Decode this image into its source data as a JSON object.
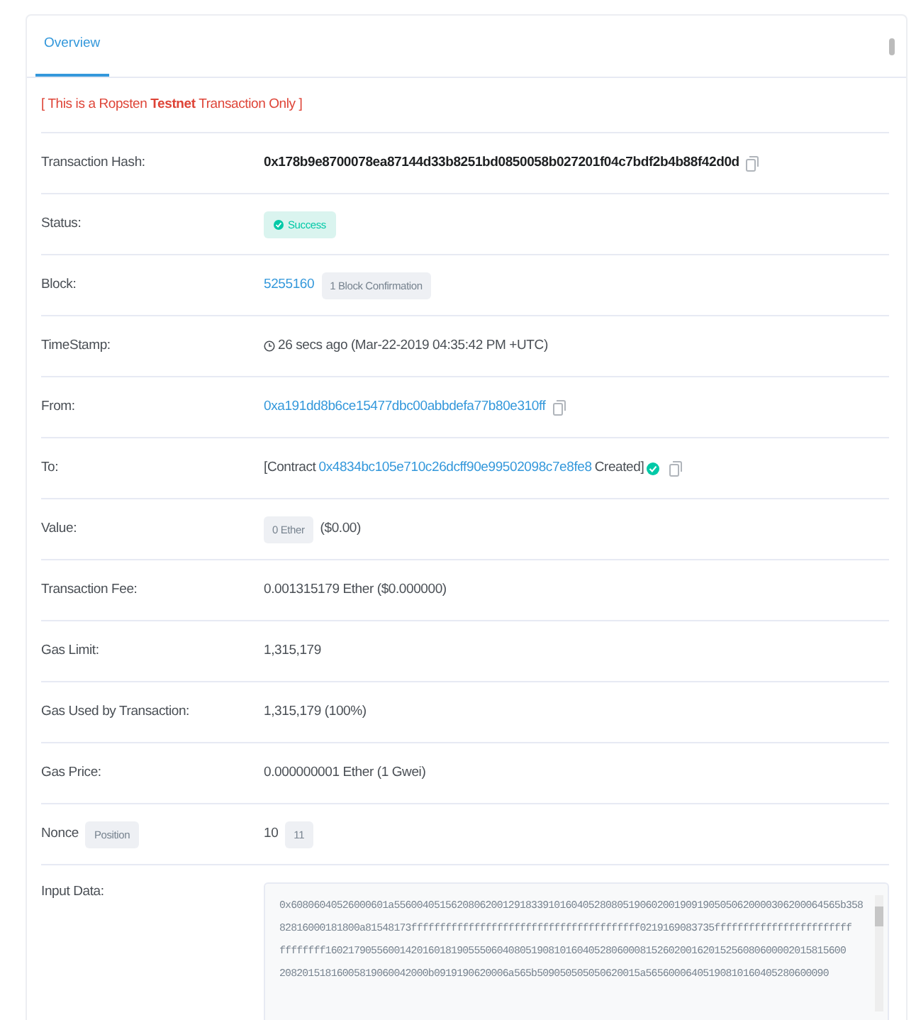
{
  "tabs": [
    {
      "label": "Overview",
      "selected": true
    }
  ],
  "notice": "[ This is a Ropsten **Testnet** Transaction Only ]",
  "rows": [
    {
      "kind": "hash",
      "label": "Transaction Hash:",
      "value": "0x178b9e8700078ea87144d33b8251bd0850058b027201f04c7bdf2b4b88f42d0d"
    },
    {
      "kind": "status",
      "label": "Status:",
      "value": "Success"
    },
    {
      "kind": "block",
      "label": "Block:",
      "value": "5255160",
      "badge": "1 Block Confirmation"
    },
    {
      "kind": "time",
      "label": "TimeStamp:",
      "value": "26 secs ago (Mar-22-2019 04:35:42 PM +UTC)"
    },
    {
      "kind": "address",
      "label": "From:",
      "value": "0xa191dd8b6ce15477dbc00abbdefa77b80e310ff"
    },
    {
      "kind": "contract",
      "label": "To:",
      "prefix": "[Contract",
      "value": "0x4834bc105e710c26dcff90e99502098c7e8fe8",
      "suffix": "Created]"
    },
    {
      "kind": "amount",
      "label": "Value:",
      "value": "0 Ether",
      "extra": "($0.00)"
    },
    {
      "kind": "text",
      "label": "Transaction Fee:",
      "value": "0.001315179 Ether ($0.000000)"
    },
    {
      "kind": "text",
      "label": "Gas Limit:",
      "value": "1,315,179"
    },
    {
      "kind": "text",
      "label": "Gas Used by Transaction:",
      "value": "1,315,179 (100%)"
    },
    {
      "kind": "text",
      "label": "Gas Price:",
      "value": "0.000000001 Ether (1 Gwei)"
    },
    {
      "kind": "nonce",
      "label": "Nonce",
      "label_badge": "Position",
      "value": "10",
      "badge": "11"
    },
    {
      "kind": "input",
      "label": "Input Data:",
      "lines": [
        "0x60806040526000601a556004051562080620012918339101604052808051906020019091905050620000306200064565b358",
        "82816000181800a81548173ffffffffffffffffffffffffffffffffffffffff0219169083735ffffffffffffffffffffffff",
        "ffffffff1602179055600142016018190555060408051908101604052806000815260200162015256080600002015815600",
        "20820151816005819060042000b0919190620006a565b509050505050620015a56560006405190810160405280600090"
      ]
    }
  ]
}
